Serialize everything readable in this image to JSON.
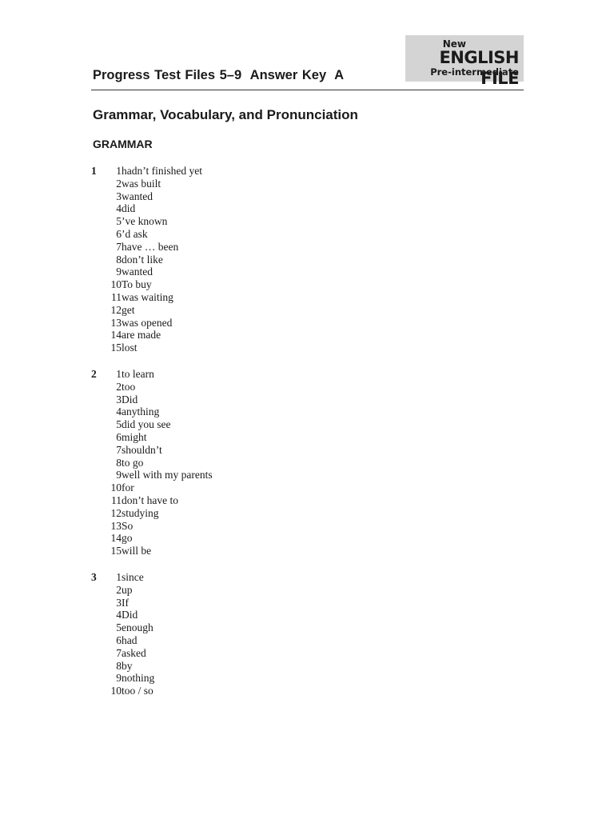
{
  "logo": {
    "line1": "New",
    "line2": "ENGLISH FILE",
    "line3": "Pre-intermediate"
  },
  "header": {
    "title": "Progress Test Files 5–9  Answer Key",
    "version": "A"
  },
  "section": {
    "title": "Grammar, Vocabulary, and Pronunciation",
    "subsection": "GRAMMAR"
  },
  "exercises": [
    {
      "number": "1",
      "items": [
        {
          "n": "1",
          "a": "hadn’t finished yet"
        },
        {
          "n": "2",
          "a": "was built"
        },
        {
          "n": "3",
          "a": "wanted"
        },
        {
          "n": "4",
          "a": "did"
        },
        {
          "n": "5",
          "a": "’ve known"
        },
        {
          "n": "6",
          "a": "’d ask"
        },
        {
          "n": "7",
          "a": "have … been"
        },
        {
          "n": "8",
          "a": "don’t like"
        },
        {
          "n": "9",
          "a": "wanted"
        },
        {
          "n": "10",
          "a": "To buy"
        },
        {
          "n": "11",
          "a": "was waiting"
        },
        {
          "n": "12",
          "a": "get"
        },
        {
          "n": "13",
          "a": "was opened"
        },
        {
          "n": "14",
          "a": "are made"
        },
        {
          "n": "15",
          "a": "lost"
        }
      ]
    },
    {
      "number": "2",
      "items": [
        {
          "n": "1",
          "a": "to learn"
        },
        {
          "n": "2",
          "a": "too"
        },
        {
          "n": "3",
          "a": "Did"
        },
        {
          "n": "4",
          "a": "anything"
        },
        {
          "n": "5",
          "a": "did you see"
        },
        {
          "n": "6",
          "a": "might"
        },
        {
          "n": "7",
          "a": "shouldn’t"
        },
        {
          "n": "8",
          "a": "to go"
        },
        {
          "n": "9",
          "a": "well with my parents"
        },
        {
          "n": "10",
          "a": "for"
        },
        {
          "n": "11",
          "a": "don’t have to"
        },
        {
          "n": "12",
          "a": "studying"
        },
        {
          "n": "13",
          "a": "So"
        },
        {
          "n": "14",
          "a": "go"
        },
        {
          "n": "15",
          "a": "will be"
        }
      ]
    },
    {
      "number": "3",
      "items": [
        {
          "n": "1",
          "a": "since"
        },
        {
          "n": "2",
          "a": "up"
        },
        {
          "n": "3",
          "a": "If"
        },
        {
          "n": "4",
          "a": "Did"
        },
        {
          "n": "5",
          "a": "enough"
        },
        {
          "n": "6",
          "a": "had"
        },
        {
          "n": "7",
          "a": "asked"
        },
        {
          "n": "8",
          "a": "by"
        },
        {
          "n": "9",
          "a": "nothing"
        },
        {
          "n": "10",
          "a": "too / so"
        }
      ]
    }
  ]
}
